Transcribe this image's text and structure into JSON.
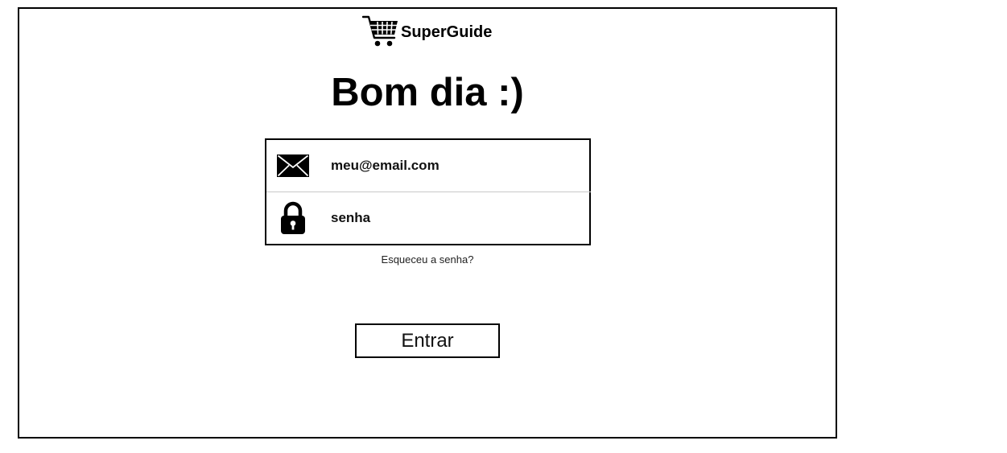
{
  "brand": {
    "name": "SuperGuide",
    "icon": "shopping-cart-icon"
  },
  "greeting": "Bom dia :)",
  "login_form": {
    "email": {
      "icon": "envelope-icon",
      "placeholder": "meu@email.com",
      "value": ""
    },
    "password": {
      "icon": "padlock-icon",
      "placeholder": "senha",
      "value": ""
    },
    "forgot_password_label": "Esqueceu a senha?",
    "submit_label": "Entrar"
  }
}
